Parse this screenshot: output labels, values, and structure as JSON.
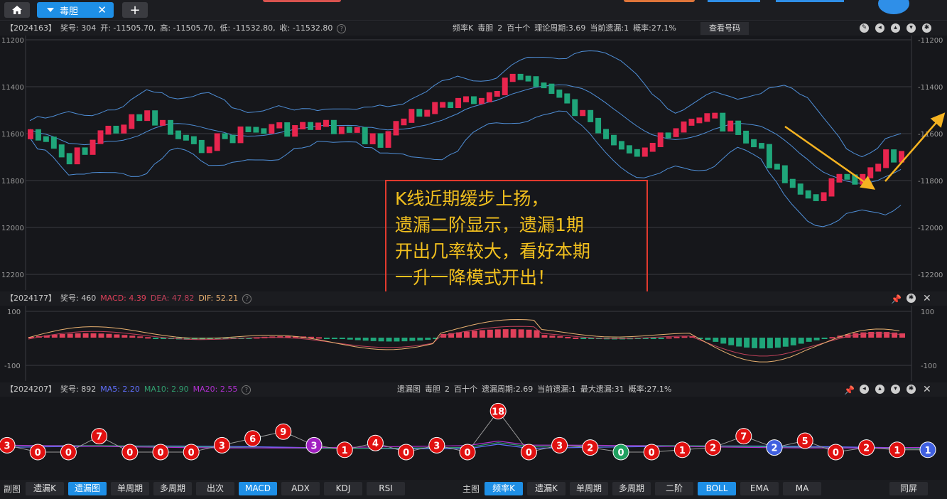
{
  "tabs": {
    "active_label": "毒胆"
  },
  "main_chart": {
    "info": {
      "period": "【2024163】",
      "prize": "奖号: 304",
      "open": "开: -11505.70,",
      "high": "高: -11505.70,",
      "low": "低: -11532.80,",
      "close": "收: -11532.80"
    },
    "meta": {
      "type": "频率K",
      "name": "毒胆",
      "num": "2",
      "pos": "百十个",
      "theory_period": "理论周期:3.69",
      "current_miss": "当前遗漏:1",
      "prob": "概率:27.1%"
    },
    "code_button": "查看号码",
    "y_axis_left": [
      "11200",
      "11400",
      "11600",
      "11800",
      "12000",
      "12200"
    ],
    "y_axis_right": [
      "-11200",
      "-11400",
      "-11600",
      "-11800",
      "-12000",
      "-12200"
    ]
  },
  "annotation": {
    "lines": [
      "K线近期缓步上扬，",
      "遗漏二阶显示，遗漏1期",
      "开出几率较大，看好本期",
      "一升一降模式开出！"
    ],
    "border_color": "#e23a2e",
    "text_color": "#f2c01e"
  },
  "macd_panel": {
    "period": "【2024177】",
    "prize": "奖号: 460",
    "macd": "MACD: 4.39",
    "dea": "DEA: 47.82",
    "dif": "DIF: 52.21",
    "y_top": "100",
    "y_bottom": "-100",
    "colors": {
      "macd": "#e0405a",
      "dea": "#c0405a",
      "dif": "#e8b070"
    }
  },
  "miss_panel": {
    "period": "【2024207】",
    "prize": "奖号: 892",
    "ma5": "MA5: 2.20",
    "ma10": "MA10: 2.90",
    "ma20": "MA20: 2.55",
    "type": "遗漏图",
    "name": "毒胆",
    "num": "2",
    "pos": "百十个",
    "miss_period": "遗漏周期:2.69",
    "current_miss": "当前遗漏:1",
    "max_miss": "最大遗漏:31",
    "prob": "概率:27.1%",
    "colors": {
      "ma5": "#6070ff",
      "ma10": "#30a070",
      "ma20": "#b030d0"
    },
    "points": [
      {
        "v": "3",
        "c": "#e01010"
      },
      {
        "v": "0",
        "c": "#e01010"
      },
      {
        "v": "0",
        "c": "#e01010"
      },
      {
        "v": "7",
        "c": "#e01010"
      },
      {
        "v": "0",
        "c": "#e01010"
      },
      {
        "v": "0",
        "c": "#e01010"
      },
      {
        "v": "0",
        "c": "#e01010"
      },
      {
        "v": "3",
        "c": "#e01010"
      },
      {
        "v": "6",
        "c": "#e01010"
      },
      {
        "v": "9",
        "c": "#e01010"
      },
      {
        "v": "3",
        "c": "#a020c0"
      },
      {
        "v": "1",
        "c": "#e01010"
      },
      {
        "v": "4",
        "c": "#e01010"
      },
      {
        "v": "0",
        "c": "#e01010"
      },
      {
        "v": "3",
        "c": "#e01010"
      },
      {
        "v": "0",
        "c": "#e01010"
      },
      {
        "v": "18",
        "c": "#e01010"
      },
      {
        "v": "0",
        "c": "#e01010"
      },
      {
        "v": "3",
        "c": "#e01010"
      },
      {
        "v": "2",
        "c": "#e01010"
      },
      {
        "v": "0",
        "c": "#20a060"
      },
      {
        "v": "0",
        "c": "#e01010"
      },
      {
        "v": "1",
        "c": "#e01010"
      },
      {
        "v": "2",
        "c": "#e01010"
      },
      {
        "v": "7",
        "c": "#e01010"
      },
      {
        "v": "2",
        "c": "#4060e0"
      },
      {
        "v": "5",
        "c": "#e01010"
      },
      {
        "v": "0",
        "c": "#e01010"
      },
      {
        "v": "2",
        "c": "#e01010"
      },
      {
        "v": "1",
        "c": "#e01010"
      },
      {
        "v": "1",
        "c": "#4060e0"
      }
    ]
  },
  "bottom_bar": {
    "sub_label": "副图",
    "sub_buttons": [
      "遗漏K",
      "遗漏图",
      "单周期",
      "多周期",
      "出次",
      "MACD",
      "ADX",
      "KDJ",
      "RSI"
    ],
    "main_label": "主图",
    "main_buttons": [
      "频率K",
      "遗漏K",
      "单周期",
      "多周期",
      "二阶",
      "BOLL",
      "EMA",
      "MA"
    ],
    "fullscreen": "同屏"
  }
}
